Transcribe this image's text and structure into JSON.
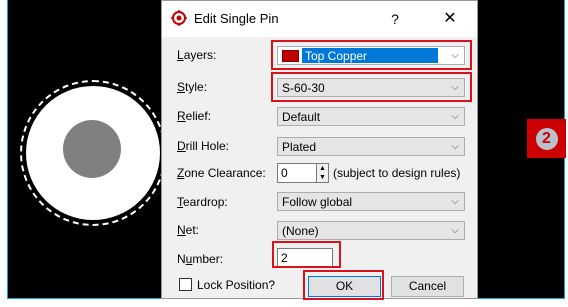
{
  "dialog": {
    "title": "Edit Single Pin",
    "help": "?",
    "close": "✕"
  },
  "fields": {
    "layers": {
      "label_u": "L",
      "label_rest": "ayers:",
      "value": "Top Copper"
    },
    "style": {
      "label_u": "S",
      "label_rest": "tyle:",
      "value": "S-60-30"
    },
    "relief": {
      "label_u": "R",
      "label_rest": "elief:",
      "value": "Default"
    },
    "drill": {
      "label_u": "D",
      "label_rest": "rill Hole:",
      "value": "Plated"
    },
    "zone": {
      "label_u": "Z",
      "label_rest": "one Clearance:",
      "value": "0",
      "note": "(subject to design rules)"
    },
    "teardrop": {
      "label_u": "T",
      "label_rest": "eardrop:",
      "value": "Follow global"
    },
    "net": {
      "label_u": "N",
      "label_rest": "et:",
      "value": "(None)"
    },
    "number": {
      "label_pre": "N",
      "label_u": "u",
      "label_rest": "mber:",
      "value": "2"
    },
    "lock": {
      "label": "Lock Position?"
    }
  },
  "buttons": {
    "ok": "OK",
    "cancel": "Cancel"
  },
  "badge": {
    "text": "2"
  },
  "colors": {
    "highlight": "#d9131b",
    "layer": "#c00000",
    "selection": "#0078d7",
    "badge": "#cc0000"
  }
}
